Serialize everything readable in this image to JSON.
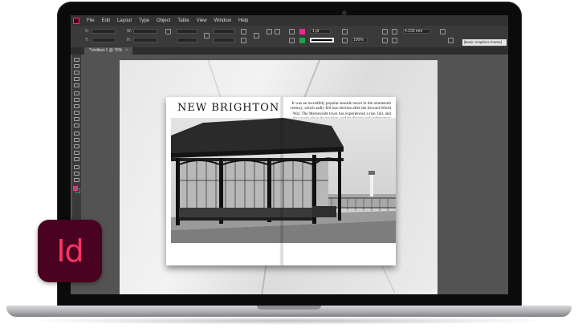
{
  "menu": {
    "items": [
      "File",
      "Edit",
      "Layout",
      "Type",
      "Object",
      "Table",
      "View",
      "Window",
      "Help"
    ]
  },
  "control": {
    "x_label": "X:",
    "y_label": "Y:",
    "w_label": "W:",
    "h_label": "H:",
    "stroke_weight": "1 pt",
    "opacity": "100%",
    "dimension": "4.233 mm",
    "workspace": "[Basic Graphics Frame]"
  },
  "document": {
    "tab_label": "*Untitled-1 @ 76%",
    "close_symbol": "×"
  },
  "magazine": {
    "title": "NEW BRIGHTON",
    "body": "It was an incredibly popular seaside resort in the nineteenth century, which sadly fell into decline after the Second World War. The Merseyside town has experienced a rise, fall, and rise again since its creation, and its design and architecture has had a major part to play"
  },
  "logo": {
    "text": "Id"
  },
  "colors": {
    "logo_bg": "#49021f",
    "logo_fg": "#ff3366",
    "fill_swatch": "#ef2a8a",
    "stroke_swatch": "#1fa34a"
  }
}
